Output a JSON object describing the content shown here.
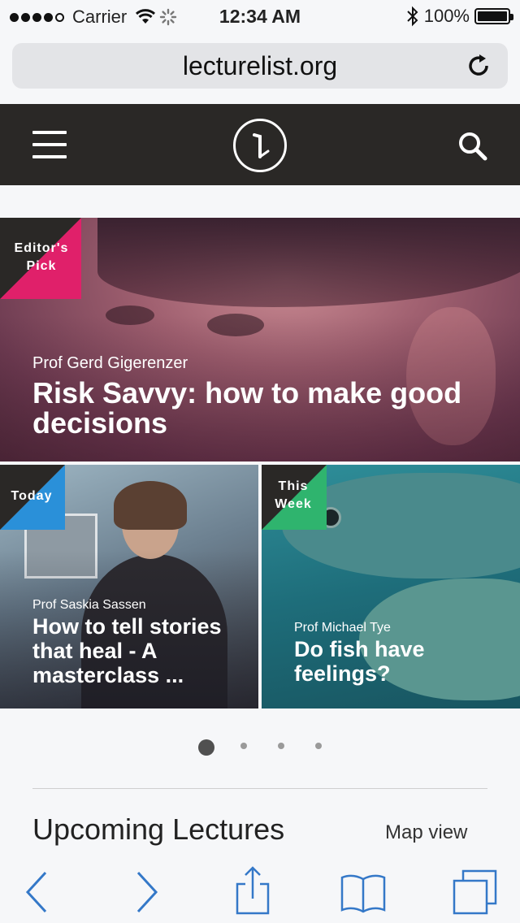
{
  "status": {
    "carrier": "Carrier",
    "time": "12:34 AM",
    "battery": "100%",
    "battery_level": 1.0,
    "signal_bars": 4
  },
  "browser": {
    "url": "lecturelist.org"
  },
  "hero": {
    "badge": "Editor's Pick",
    "badge_color": "#e0206a",
    "author": "Prof Gerd Gigerenzer",
    "title": "Risk Savvy: how to make good decisions"
  },
  "tiles": [
    {
      "badge": "Today",
      "badge_color": "#2a90d9",
      "author": "Prof Saskia Sassen",
      "title": "How to tell stories that heal - A masterclass ..."
    },
    {
      "badge": "This Week",
      "badge_color": "#2fb46e",
      "author": "Prof Michael Tye",
      "title": "Do fish have feelings?"
    }
  ],
  "pager": {
    "pages": 4,
    "current": 1
  },
  "section": {
    "title": "Upcoming Lectures",
    "map_link": "Map view"
  },
  "colors": {
    "header_bg": "#2a2826",
    "toolbar_icon": "#3478c8"
  },
  "toolbar_icons": [
    "back-icon",
    "forward-icon",
    "share-icon",
    "bookmarks-icon",
    "tabs-icon"
  ]
}
